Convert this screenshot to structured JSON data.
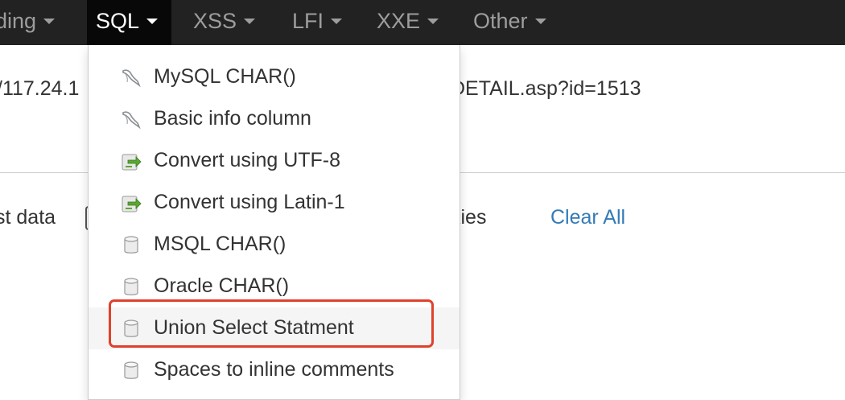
{
  "navbar": {
    "items": [
      {
        "label": "ding",
        "icon": "chevron-down-icon"
      },
      {
        "label": "SQL",
        "icon": "chevron-down-icon",
        "active": true
      },
      {
        "label": "XSS",
        "icon": "chevron-down-icon"
      },
      {
        "label": "LFI",
        "icon": "chevron-down-icon"
      },
      {
        "label": "XXE",
        "icon": "chevron-down-icon"
      },
      {
        "label": "Other",
        "icon": "chevron-down-icon"
      }
    ],
    "colors": {
      "background": "#222222",
      "active_background": "#080808",
      "text": "#9d9d9d",
      "active_text": "#ffffff"
    }
  },
  "url_bar": {
    "left_text": "/117.24.1",
    "right_text": "DETAIL.asp?id=1513"
  },
  "options_row": {
    "left_text": "st data",
    "right_text": "kies",
    "clear_all": "Clear All"
  },
  "sql_menu": {
    "items": [
      {
        "label": "MySQL CHAR()",
        "icon": "mysql-dolphin-icon"
      },
      {
        "label": "Basic info column",
        "icon": "mysql-dolphin-icon"
      },
      {
        "label": "Convert using UTF-8",
        "icon": "convert-icon"
      },
      {
        "label": "Convert using Latin-1",
        "icon": "convert-icon"
      },
      {
        "label": "MSQL CHAR()",
        "icon": "database-icon"
      },
      {
        "label": "Oracle CHAR()",
        "icon": "database-icon"
      },
      {
        "label": "Union Select Statment",
        "icon": "database-icon",
        "hovered": true,
        "highlighted": true
      },
      {
        "label": "Spaces to inline comments",
        "icon": "database-icon"
      }
    ],
    "highlight_color": "#e0412b"
  }
}
